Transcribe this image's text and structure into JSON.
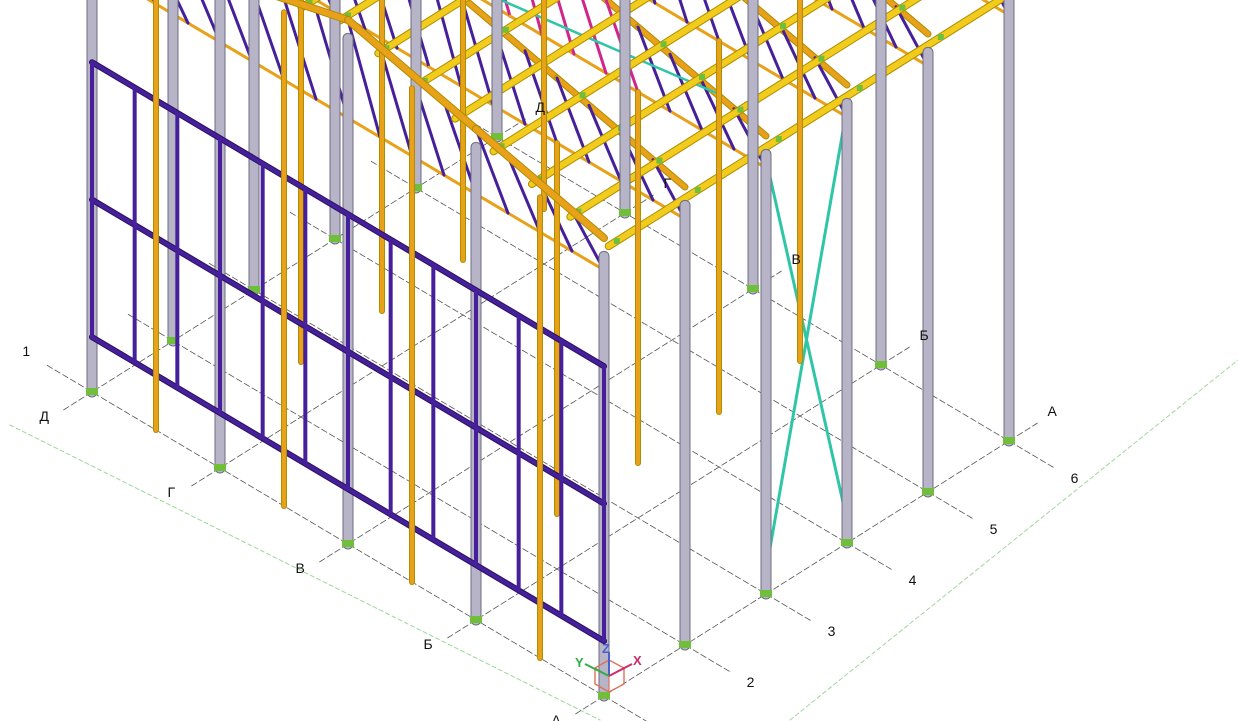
{
  "colors": {
    "background": "#ffffff",
    "grid_line": "#555555",
    "ground_hint": "#9fd79a",
    "column": "#b6b4c6",
    "column_edge": "#6f6d82",
    "purlin": "#f1cc1c",
    "purlin_edge": "#b08c00",
    "rafter": "#e8a21a",
    "brace_truss": "#46209a",
    "brace_magenta": "#d0268c",
    "brace_cyan": "#2fc6a8",
    "node": "#6fbf3a",
    "hanger": "#b9a7d6",
    "triad_x": "#cc2a6a",
    "triad_y": "#2fae44",
    "triad_z": "#4a5fd0",
    "triad_box": "#e0705a"
  },
  "grid": {
    "letter_axes": [
      {
        "id": "Д",
        "label": "Д"
      },
      {
        "id": "Г",
        "label": "Г"
      },
      {
        "id": "В",
        "label": "В"
      },
      {
        "id": "Б",
        "label": "Б"
      },
      {
        "id": "А",
        "label": "А"
      }
    ],
    "number_axes": [
      {
        "id": "1",
        "label": "1"
      },
      {
        "id": "2",
        "label": "2"
      },
      {
        "id": "3",
        "label": "3"
      },
      {
        "id": "4",
        "label": "4"
      },
      {
        "id": "5",
        "label": "5"
      },
      {
        "id": "6",
        "label": "6"
      }
    ]
  },
  "triad": {
    "x": "X",
    "y": "Y",
    "z": "Z"
  }
}
